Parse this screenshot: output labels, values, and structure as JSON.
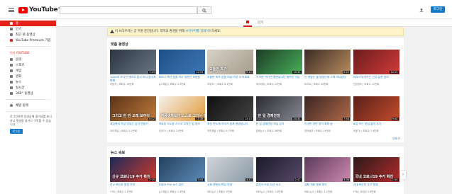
{
  "header": {
    "logo_text": "YouTube",
    "logo_region": "KR",
    "search_placeholder": "",
    "login_label": "로그인"
  },
  "sidebar": {
    "items": [
      {
        "label": "홈",
        "icon": "home-icon",
        "active": true
      },
      {
        "label": "인기",
        "icon": "fire-icon"
      },
      {
        "label": "최근 본 동영상",
        "icon": "history-icon"
      },
      {
        "label": "YouTube Premium 가입",
        "icon": "youtube-icon"
      }
    ],
    "best_title": "인기 YOUTUBE",
    "best_items": [
      "음악",
      "스포츠",
      "게임",
      "영화",
      "뉴스",
      "실시간",
      "360° 동영상"
    ],
    "browse_label": "채널 탐색",
    "signin_note": "로그인하면 동영상에 좋아요를 표시하고 댓글을 달거나 구독할 수 있습니다.",
    "login_label": "로그인"
  },
  "tabs": {
    "home_label": "홈",
    "trending_label": "인기"
  },
  "notice": {
    "text": "이 브라우저는 곧 지원 중단됩니다. 최적의 환경을 위해 ",
    "link": "브라우저를 업데이트",
    "suffix": "하세요."
  },
  "shelf1": {
    "title": "맞춤 동영상",
    "more": "더보기",
    "row1": [
      {
        "caption": "",
        "duration": "7:23",
        "title": "1000억 유니콘 데리고 중국 아니 중국차 화제",
        "meta": "자동차 | 조회수 16만회",
        "bg": [
          "#2b3540",
          "#6a7686"
        ]
      },
      {
        "caption": "",
        "duration": "12:04",
        "title": "코로나 백신 접종 이후 달라진 부분들",
        "meta": "뉴스채널 | 조회수 3.3만회",
        "bg": [
          "#1f4f86",
          "#3d78b5"
        ]
      },
      {
        "caption": "오늘만 특가",
        "duration": "9:11",
        "title": "오늘만 특가 상품 리뷰 이것 꼭 보세요",
        "meta": "리뷰TV | 조회수 8.1만회",
        "bg": [
          "#d7d1c7",
          "#a69b8c"
        ]
      },
      {
        "caption": "",
        "duration": "15:32",
        "title": "이 버튼 하나면 충분합니다 놀라운 기능",
        "meta": "테크리뷰 | 조회수 22만회",
        "bg": [
          "#1d3b25",
          "#48b05a"
        ]
      },
      {
        "caption": "",
        "duration": "6:45",
        "title": "난 괜찮은 줄 알았는데 그게 아니었다",
        "meta": "토크쇼 | 조회수 40만회",
        "bg": [
          "#3a2b23",
          "#b88b5e"
        ]
      },
      {
        "caption": "",
        "duration": "10:20",
        "title": "의사가 알려주는 건강 습관 정리",
        "meta": "건강정보 | 조회수 12만회",
        "bg": [
          "#6b1c1c",
          "#d13a3a"
        ]
      }
    ],
    "row2": [
      {
        "caption": "그리고 한 번 오래 보아라",
        "duration": "8:02",
        "title": "세상에서 가장 맛있는 음식 만들기",
        "meta": "요리채널 | 조회수 5.2만회",
        "bg": [
          "#5a3418",
          "#c07a3a"
        ]
      },
      {
        "caption": "역풍생체도염 스스로 고치는 법",
        "duration": "11:48",
        "title": "역류성 식도염 스스로 고치는 법 정리",
        "meta": "건강TV | 조회수 31만회",
        "bg": [
          "#f4f1ec",
          "#e39b3c"
        ]
      },
      {
        "caption": "",
        "duration": "13:15",
        "title": "최신 반도체 이야기 쉽게 설명합니다",
        "meta": "과학채널 | 조회수 9.7만회",
        "bg": [
          "#0f0f0f",
          "#444444"
        ]
      },
      {
        "caption": "한 일 경제전쟁",
        "duration": "20:31",
        "title": "한 일 경제전쟁 핵심 정리",
        "meta": "경제뉴스 | 조회수 56만회",
        "bg": [
          "#2a2a30",
          "#8a8a96"
        ]
      },
      {
        "caption": "",
        "duration": "7:58",
        "title": "이것만 알면 영어 회화 끝",
        "meta": "영어공부 | 조회수 14만회",
        "bg": [
          "#3a2420",
          "#b06a4a"
        ]
      },
      {
        "caption": "",
        "duration": "9:40",
        "title": "요즘 뜨는 맛집 솔직 후기",
        "meta": "먹방TV | 조회수 7.4만회",
        "bg": [
          "#5a2018",
          "#c44c2c"
        ]
      }
    ]
  },
  "shelf2": {
    "title": "뉴스 속보",
    "row1": [
      {
        "caption": "신규 코로나19 추가 확진",
        "duration": "2:15",
        "title": "신규 확진자 발생 속보",
        "meta": "YTN | 조회수 2.1만회",
        "bg": [
          "#1b2a5a",
          "#d23a2a"
        ]
      },
      {
        "caption": "",
        "duration": "3:02",
        "title": "오늘의 주요 뉴스 정리",
        "meta": "뉴스채널 | 조회수 1.4만회",
        "bg": [
          "#24415e",
          "#5c8bb8"
        ]
      },
      {
        "caption": "",
        "duration": "4:11",
        "title": "국회 본회의 현장 연결",
        "meta": "SBS뉴스 | 조회수 9천회",
        "bg": [
          "#cfd4d8",
          "#8a99a6"
        ]
      },
      {
        "caption": "",
        "duration": "2:47",
        "title": "밤사이 주요 사건 사고",
        "meta": "KBS뉴스 | 조회수 1.8만회",
        "bg": [
          "#1a1a2a",
          "#5a4a6a"
        ]
      },
      {
        "caption": "",
        "duration": "3:36",
        "title": "경제 지표 발표 분석",
        "meta": "MBC뉴스 | 조회수 1.1만회",
        "bg": [
          "#5a3a5a",
          "#d08ab0"
        ]
      },
      {
        "caption": "국내 코로나19 추가 확진",
        "duration": "2:58",
        "title": "국내 확진자 추가 발생",
        "meta": "YTN | 조회수 2.6만회",
        "bg": [
          "#2a1a1a",
          "#b22a2a"
        ]
      }
    ]
  },
  "next_arrow": "›"
}
